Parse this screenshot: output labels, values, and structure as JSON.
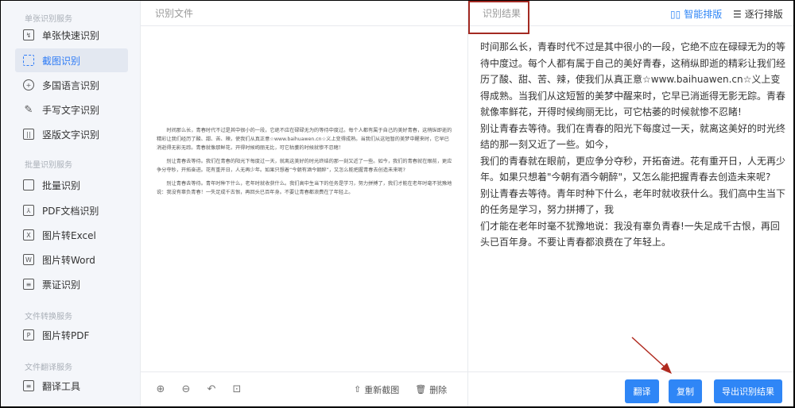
{
  "sidebar": {
    "sections": [
      "单张识别服务",
      "批量识别服务",
      "文件转换服务",
      "文件翻译服务"
    ],
    "items": [
      {
        "label": "单张快速识别",
        "icon": "quick-scan-icon"
      },
      {
        "label": "截图识别",
        "icon": "crop-icon",
        "active": true
      },
      {
        "label": "多国语言识别",
        "icon": "globe-icon"
      },
      {
        "label": "手写文字识别",
        "icon": "pen-icon"
      },
      {
        "label": "竖版文字识别",
        "icon": "vertical-text-icon"
      },
      {
        "label": "批量识别",
        "icon": "batch-icon"
      },
      {
        "label": "PDF文档识别",
        "icon": "pdf-icon"
      },
      {
        "label": "图片转Excel",
        "icon": "excel-icon"
      },
      {
        "label": "图片转Word",
        "icon": "word-icon"
      },
      {
        "label": "票证识别",
        "icon": "ticket-icon"
      },
      {
        "label": "图片转PDF",
        "icon": "pdf-convert-icon"
      },
      {
        "label": "翻译工具",
        "icon": "translate-icon"
      }
    ]
  },
  "left": {
    "title": "识别文件",
    "preview": [
      "时间那么长，青春时代不过是其中很小的一段，它绝不应在碌碌无为的等待中度过。每个人都有属于自己的美好青春，这稍纵即逝的精彩让我们经历了酸、甜、苦、辣，使我们从真正意☆www.baihuawen.cn☆义上变得成熟。当我们从这短暂的美梦中醒来时，它早已消逝得无影无踪。青春就像那鲜花，开得时候绚丽无比，可它枯萎的时候就惨不忍睹！",
      "别让青春去等待。我们在青春的阳光下每度过一天，就离这美好的时光终结的那一刻又近了一些。如今，我们的青春就在眼前，更应争分夺秒，开拓奋进。花有重开日，人无再少年。如果只想着“今朝有酒今朝醉”，又怎么能把握青春去创造未来呢?",
      "别让青春去等待。青年时种下什么，老年时就收获什么。我们高中生当下的任务是学习，努力拼搏了，我们才能在老年时毫不犹豫地说：我没有辜负青春！一失足成千古恨，再回头已百年身。不要让青春都浪费在了年轻上。"
    ],
    "toolbar": {
      "zoom_in": "zoom-in-icon",
      "zoom_out": "zoom-out-icon",
      "rotate": "rotate-icon",
      "fit": "fit-icon",
      "recapture": "重新截图",
      "delete": "删除"
    }
  },
  "right": {
    "title": "识别结果",
    "smart_layout": "智能排版",
    "line_layout": "逐行排版",
    "result": "时间那么长，青春时代不过是其中很小的一段，它绝不应在碌碌无为的等待中度过。每个人都有属于自己的美好青春，这稍纵即逝的精彩让我们经历了酸、甜、苦、辣，使我们从真正意☆www.baihuawen.cn☆义上变得成熟。当我们从这短暂的美梦中醒来时，它早已消逝得无影无踪。青春就像率鲜花，开得时候绚丽无比，可它枯萎的时候就惨不忍睹!\n别让青春去等待。我们在青春的阳光下每度过一天，就离这美好的时光终结的那一刻又近了一些。如今，\n我们的青春就在眼前，更应争分夺秒，开拓奋进。花有重开日，人无再少年。如果只想着\"今朝有酒今朝醉\"，又怎么能把握青春去创造未来呢?\n别让青春去等待。青年时种下什么，老年时就收获什么。我们高中生当下的任务是学习，努力拼搏了，我\n们才能在老年时毫不犹豫地说：我没有辜负青春!一失足成千古恨，再回头已百年身。不要让青春都浪费在了年轻上。",
    "buttons": {
      "translate": "翻译",
      "copy": "复制",
      "export": "导出识别结果"
    }
  },
  "colors": {
    "accent": "#2f86f6",
    "annotation": "#a32a22"
  }
}
